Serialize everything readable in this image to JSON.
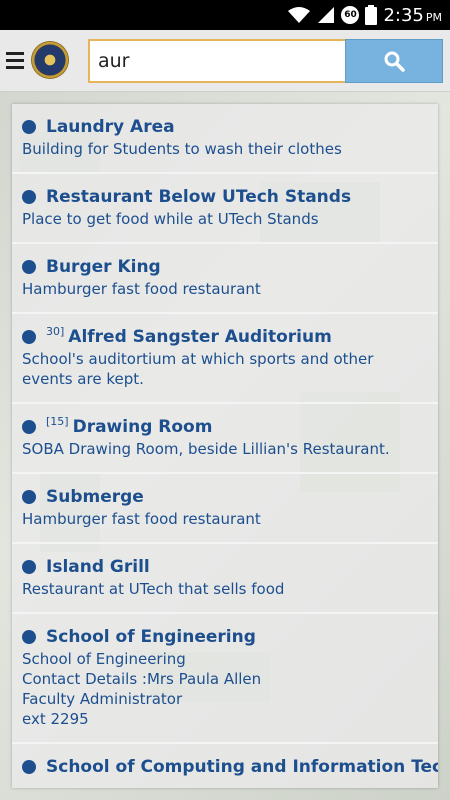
{
  "status_bar": {
    "time": "2:35",
    "ampm": "PM",
    "badge": "60"
  },
  "app_bar": {
    "menu_icon": "menu-icon",
    "logo": "university-seal",
    "search_value": "aur",
    "search_icon": "search-icon",
    "accent_color": "#e5b45b",
    "button_color": "#78b3e0"
  },
  "results": [
    {
      "prefix": "",
      "title": "Laundry Area",
      "description": "Building for Students to wash their clothes"
    },
    {
      "prefix": "",
      "title": "Restaurant Below UTech Stands",
      "description": "Place to get food while at UTech Stands"
    },
    {
      "prefix": "",
      "title": "Burger King",
      "description": "Hamburger fast food restaurant"
    },
    {
      "prefix": "30]",
      "title": "Alfred Sangster Auditorium",
      "description": "School's auditortium at which sports and other events are kept."
    },
    {
      "prefix": "[15]",
      "title": "Drawing Room",
      "description": "SOBA Drawing Room, beside Lillian's Restaurant."
    },
    {
      "prefix": "",
      "title": "Submerge",
      "description": "Hamburger fast food restaurant"
    },
    {
      "prefix": "",
      "title": "Island Grill",
      "description": "Restaurant at UTech that sells food"
    },
    {
      "prefix": "",
      "title": "School of Engineering",
      "description": "School of Engineering\nContact Details :Mrs Paula Allen\nFaculty Administrator\next 2295"
    },
    {
      "prefix": "",
      "title": "School of Computing and Information Technology",
      "description": ""
    }
  ]
}
